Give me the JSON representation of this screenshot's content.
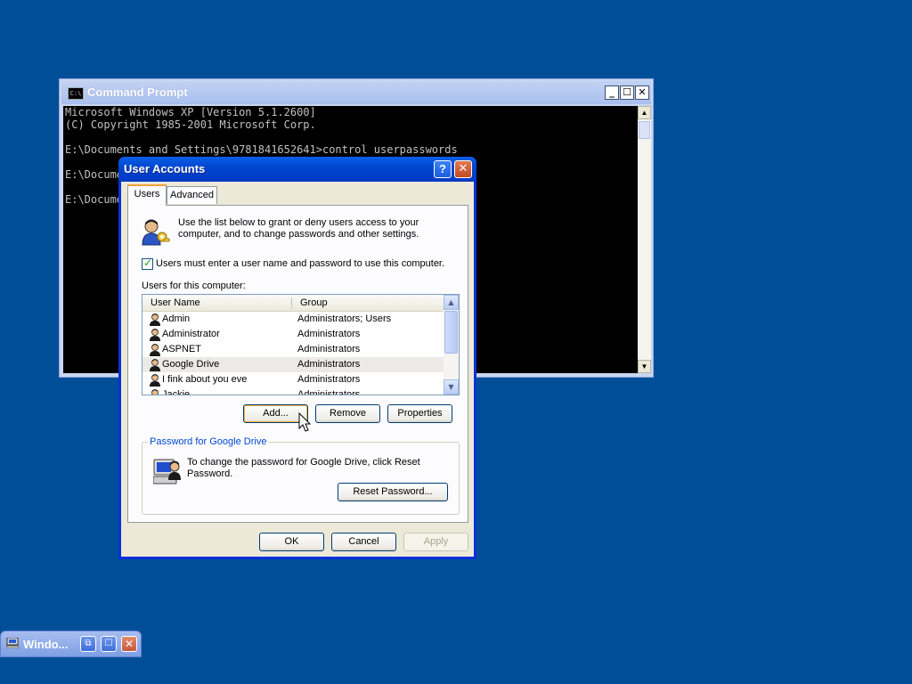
{
  "desktop": {
    "background_color": "#004e98"
  },
  "cmd_window": {
    "title": "Command Prompt",
    "icon": "cmd-icon",
    "minimize": "_",
    "maximize": "☐",
    "close": "✕",
    "lines": [
      "Microsoft Windows XP [Version 5.1.2600]",
      "(C) Copyright 1985-2001 Microsoft Corp.",
      "",
      "E:\\Documents and Settings\\9781841652641>control userpasswords",
      "",
      "E:\\Documents and Settings\\9781841652641>control userpasswords2",
      "",
      "E:\\Documents and Settings\\9781841652641>"
    ]
  },
  "user_accounts": {
    "title": "User Accounts",
    "help": "?",
    "close": "✕",
    "tabs": [
      "Users",
      "Advanced"
    ],
    "intro": "Use the list below to grant or deny users access to your computer, and to change passwords and other settings.",
    "require_login_label": "Users must enter a user name and password to use this computer.",
    "require_login_checked": true,
    "users_label": "Users for this computer:",
    "columns": [
      "User Name",
      "Group"
    ],
    "users": [
      {
        "name": "Admin",
        "group": "Administrators; Users"
      },
      {
        "name": "Administrator",
        "group": "Administrators"
      },
      {
        "name": "ASPNET",
        "group": "Administrators"
      },
      {
        "name": "Google Drive",
        "group": "Administrators",
        "selected": true
      },
      {
        "name": "I fink about you eve",
        "group": "Administrators"
      },
      {
        "name": "Jackie",
        "group": "Administrators"
      }
    ],
    "buttons": {
      "add": "Add...",
      "remove": "Remove",
      "properties": "Properties"
    },
    "password_group_title": "Password for Google Drive",
    "password_text": "To change the password for Google Drive, click Reset Password.",
    "reset_password": "Reset Password...",
    "ok": "OK",
    "cancel": "Cancel",
    "apply": "Apply"
  },
  "minimized_window": {
    "title": "Windo...",
    "restore": "⧉",
    "maximize": "☐",
    "close": "✕"
  }
}
